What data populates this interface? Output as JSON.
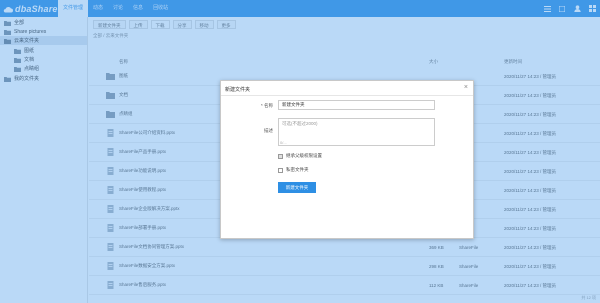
{
  "app": {
    "logo_text": "dbaShare"
  },
  "nav": [
    {
      "label": "文件管理",
      "active": true
    },
    {
      "label": "动态"
    },
    {
      "label": "讨论"
    },
    {
      "label": "信息"
    },
    {
      "label": "回收站"
    }
  ],
  "top_icons": [
    "menu-icon",
    "settings-icon",
    "user-icon",
    "grid-icon"
  ],
  "sidebar": {
    "items": [
      {
        "label": "全部",
        "level": 0,
        "selected": false
      },
      {
        "label": "Share pictures",
        "level": 0,
        "selected": false
      },
      {
        "label": "云来文件夹",
        "level": 0,
        "selected": true
      },
      {
        "label": "图纸",
        "level": 1,
        "selected": false
      },
      {
        "label": "文档",
        "level": 1,
        "selected": false
      },
      {
        "label": "点睛组",
        "level": 1,
        "selected": false
      },
      {
        "label": "我的文件夹",
        "level": 0,
        "selected": false
      }
    ]
  },
  "toolbar": {
    "buttons": [
      "新建文件夹",
      "上传",
      "下载",
      "分享",
      "移动",
      "更多"
    ]
  },
  "breadcrumb": "全部 / 云来文件夹",
  "table": {
    "header": {
      "name": "名称",
      "size": "大小",
      "date": "更新时间"
    },
    "rows": [
      {
        "kind": "folder",
        "name": "图纸",
        "size": "",
        "type": "",
        "date": "2020/11/27 14:23 / 管理员"
      },
      {
        "kind": "folder",
        "name": "文档",
        "size": "",
        "type": "",
        "date": "2020/11/27 14:23 / 管理员"
      },
      {
        "kind": "folder",
        "name": "点睛组",
        "size": "",
        "type": "",
        "date": "2020/11/27 14:23 / 管理员"
      },
      {
        "kind": "file",
        "name": "ShareFile公司介绍资料.pptx",
        "size": "",
        "type": "",
        "date": "2020/11/27 14:23 / 管理员"
      },
      {
        "kind": "file",
        "name": "ShareFile产品手册.pptx",
        "size": "",
        "type": "",
        "date": "2020/11/27 14:23 / 管理员"
      },
      {
        "kind": "file",
        "name": "ShareFile功能说明.pptx",
        "size": "",
        "type": "",
        "date": "2020/11/27 14:23 / 管理员"
      },
      {
        "kind": "file",
        "name": "ShareFile使用教程.pptx",
        "size": "",
        "type": "",
        "date": "2020/11/27 14:23 / 管理员"
      },
      {
        "kind": "file",
        "name": "ShareFile企业版解决方案.pptx",
        "size": "",
        "type": "",
        "date": "2020/11/27 14:23 / 管理员"
      },
      {
        "kind": "file",
        "name": "ShareFile部署手册.pptx",
        "size": "",
        "type": "",
        "date": "2020/11/27 14:23 / 管理员"
      },
      {
        "kind": "file",
        "name": "ShareFile文档协同管理方案.pptx",
        "size": "369 KB",
        "type": "ShareFile",
        "date": "2020/11/27 14:23 / 管理员"
      },
      {
        "kind": "file",
        "name": "ShareFile数据安全方案.pptx",
        "size": "298 KB",
        "type": "ShareFile",
        "date": "2020/11/27 14:23 / 管理员"
      },
      {
        "kind": "file",
        "name": "ShareFile售后服务.pptx",
        "size": "112 KB",
        "type": "ShareFile",
        "date": "2020/11/27 14:23 / 管理员"
      }
    ]
  },
  "status_text": "共 12 项",
  "dialog": {
    "title": "新建文件夹",
    "name_label": "* 名称",
    "name_value": "新建文件夹",
    "desc_label": "描述",
    "desc_placeholder": "可选(不超过2000)",
    "desc_count": "0/...",
    "checkbox1_label": "继承父级权限设置",
    "checkbox2_label": "私密文件夹",
    "create_label": "新建文件夹"
  }
}
